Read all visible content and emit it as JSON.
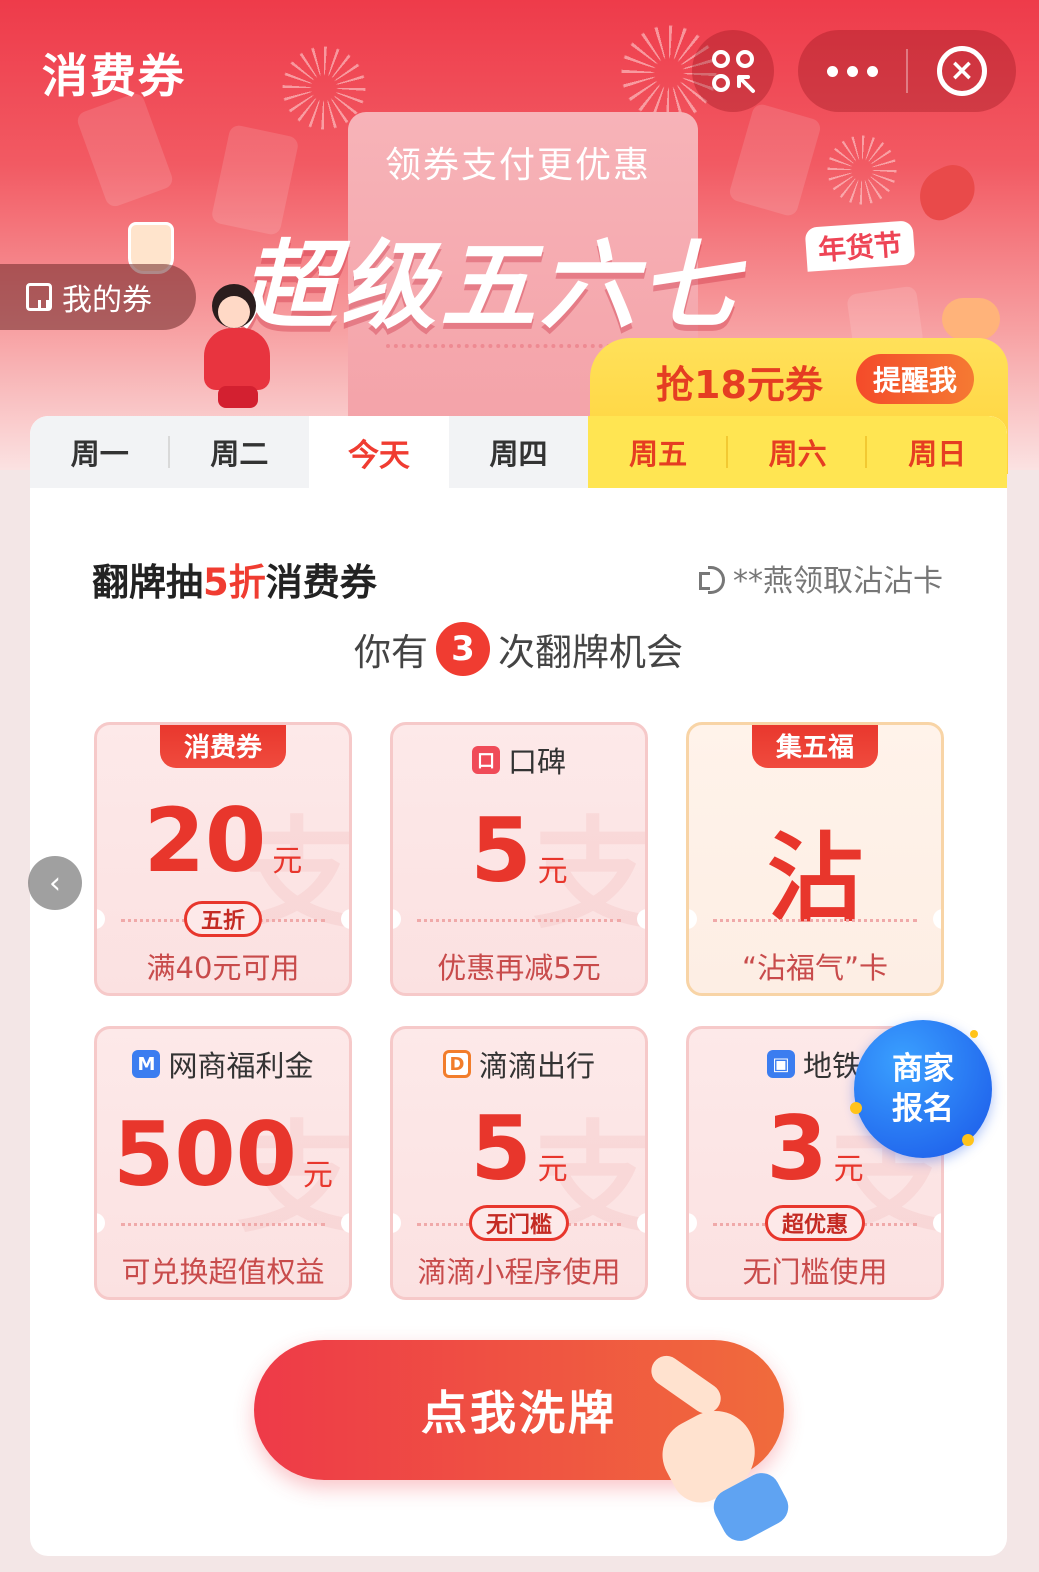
{
  "header": {
    "title": "消费券",
    "scan_icon": "scan-icon",
    "more_icon": "more-dots-icon",
    "close_icon": "close-icon",
    "close_glyph": "×"
  },
  "banner": {
    "subtitle": "领券支付更优惠",
    "title": "超级五六七",
    "festival_tag": "年货节",
    "my_coupons_label": "我的券",
    "grab_text": "抢18元券",
    "remind_label": "提醒我"
  },
  "tabs": [
    {
      "label": "周一",
      "state": "past"
    },
    {
      "label": "周二",
      "state": "past"
    },
    {
      "label": "今天",
      "state": "today"
    },
    {
      "label": "周四",
      "state": "past"
    },
    {
      "label": "周五",
      "state": "future"
    },
    {
      "label": "周六",
      "state": "future"
    },
    {
      "label": "周日",
      "state": "future"
    }
  ],
  "section": {
    "title_prefix": "翻牌抽",
    "title_highlight": "5折",
    "title_suffix": "消费券",
    "ticker": "**燕领取沾沾卡",
    "chances_prefix": "你有",
    "chances_count": "3",
    "chances_suffix": "次翻牌机会"
  },
  "coupons": [
    {
      "tag": "消费券",
      "amount": "20",
      "unit": "元",
      "pill": "五折",
      "desc": "满40元可用"
    },
    {
      "brand": "口碑",
      "amount": "5",
      "unit": "元",
      "desc": "优惠再减5元"
    },
    {
      "tag": "集五福",
      "char": "沾",
      "desc": "“沾福气”卡"
    },
    {
      "brand": "网商福利金",
      "amount": "500",
      "unit": "元",
      "desc": "可兑换超值权益"
    },
    {
      "brand": "滴滴出行",
      "amount": "5",
      "unit": "元",
      "pill": "无门槛",
      "desc": "滴滴小程序使用"
    },
    {
      "brand": "地铁",
      "amount": "3",
      "unit": "元",
      "pill": "超优惠",
      "desc": "无门槛使用"
    }
  ],
  "merchant_badge": {
    "line1": "商家",
    "line2": "报名"
  },
  "shuffle_button": "点我洗牌",
  "colors": {
    "primary": "#f03c31",
    "gold": "#ffe552",
    "blue": "#1a56e8"
  }
}
